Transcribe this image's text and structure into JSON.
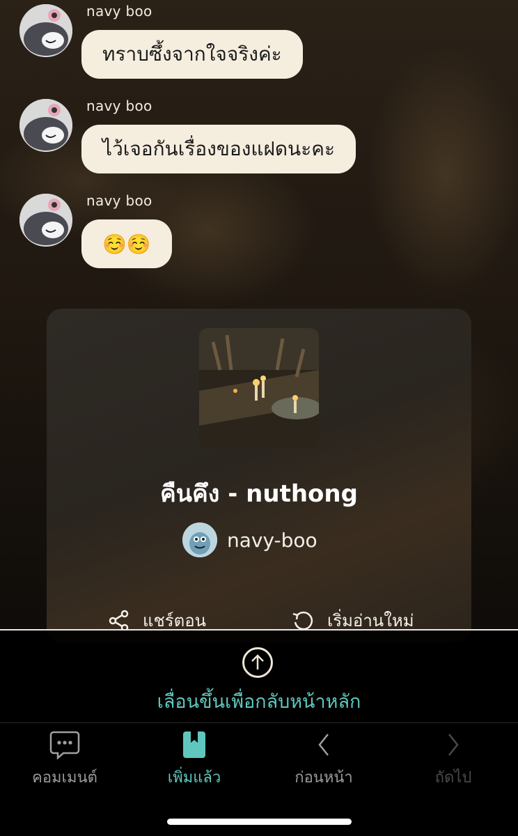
{
  "messages": [
    {
      "sender": "navy boo",
      "text": "ทราบซึ้งจากใจจริงค่ะ"
    },
    {
      "sender": "navy boo",
      "text": "ไว้เจอกันเรื่องของแฝดนะคะ"
    },
    {
      "sender": "navy boo",
      "text": "☺️☺️"
    }
  ],
  "story_card": {
    "title": "คืนคึง - nuthong",
    "author": "navy-boo",
    "share_label": "แชร์ตอน",
    "restart_label": "เริ่มอ่านใหม่"
  },
  "scroll_prompt": {
    "text": "เลื่อนขึ้นเพื่อกลับหน้าหลัก"
  },
  "tabbar": {
    "comment_label": "คอมเมนต์",
    "added_label": "เพิ่มแล้ว",
    "prev_label": "ก่อนหน้า",
    "next_label": "ถัดไป"
  },
  "colors": {
    "bubble": "#f5eedf",
    "accent": "#5fc7bd",
    "tab_active": "#5fc7bd",
    "tab_inactive": "#9a9a9a",
    "tab_disabled": "#4a4a4a"
  }
}
